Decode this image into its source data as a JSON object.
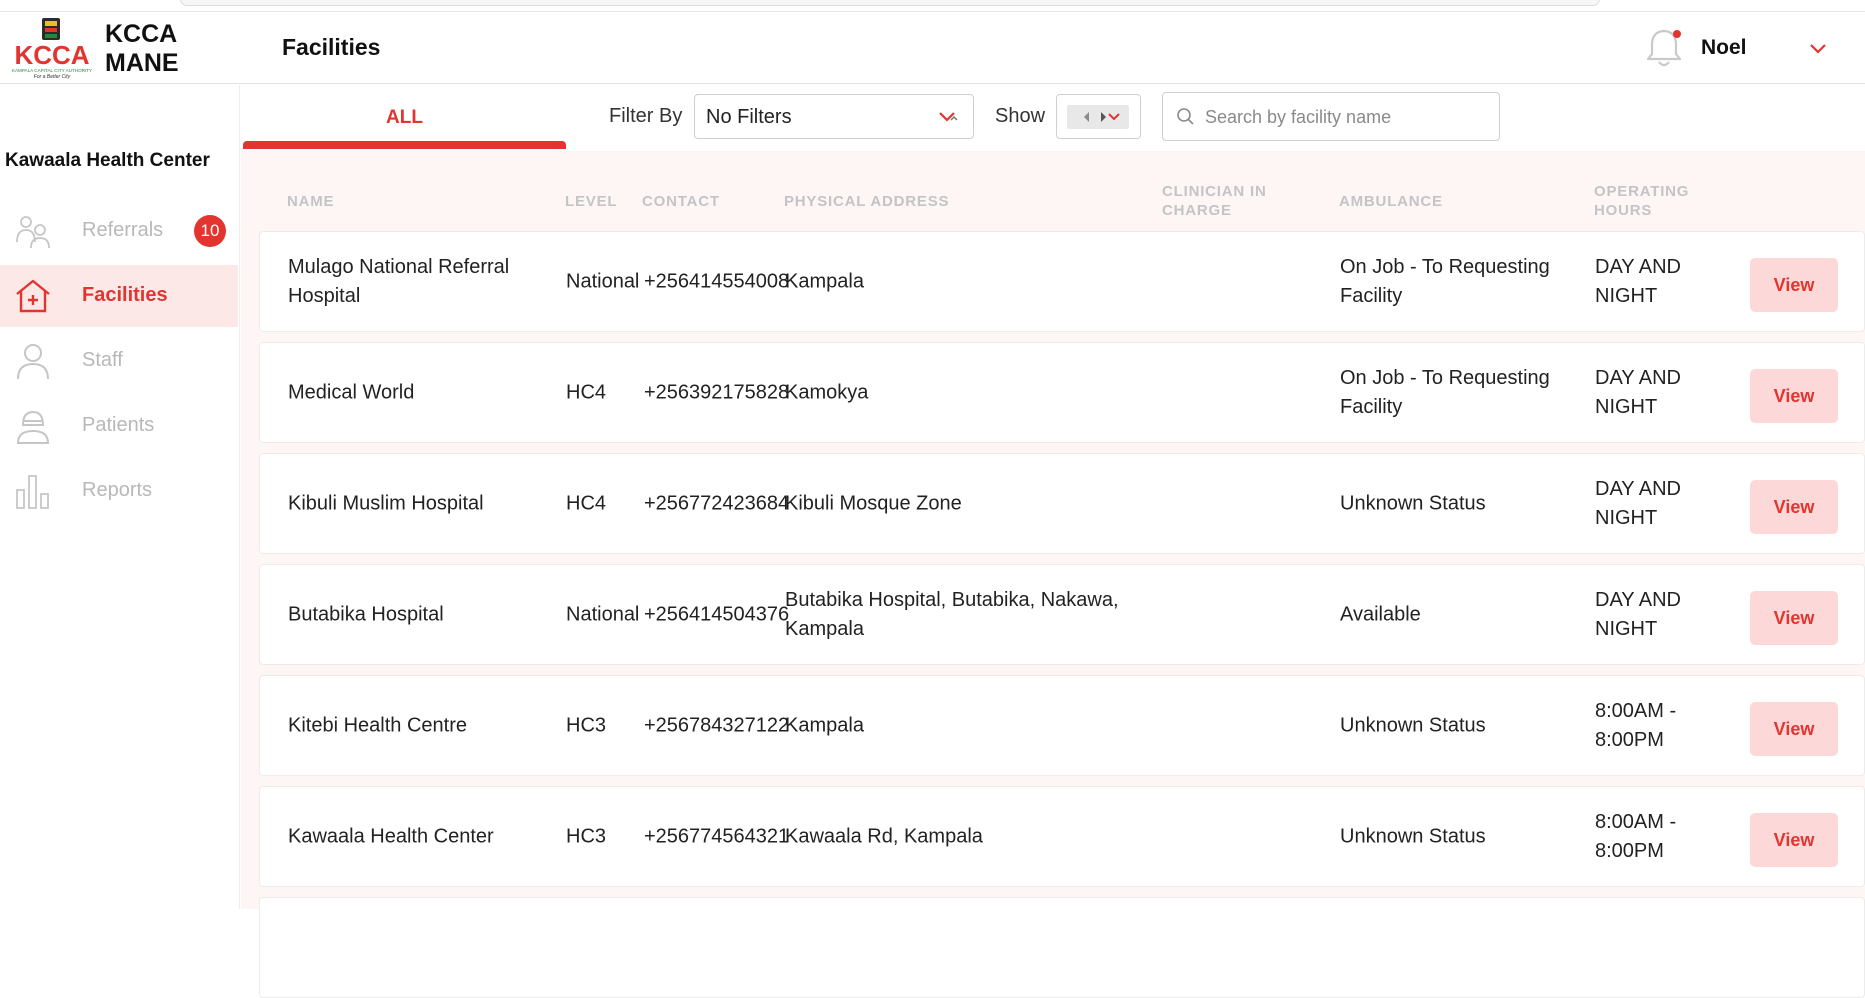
{
  "app": {
    "logo_text": "KCCA",
    "logo_subtext": "KAMPALA CAPITAL CITY AUTHORITY",
    "logo_tagline": "For a Better City",
    "brand_line1": "KCCA",
    "brand_line2": "MANE"
  },
  "header": {
    "title": "Facilities",
    "user_name": "Noel"
  },
  "sidebar": {
    "facility_name": "Kawaala Health Center",
    "items": [
      {
        "label": "Referrals",
        "icon": "referrals-icon",
        "badge": "10"
      },
      {
        "label": "Facilities",
        "icon": "hospital-icon",
        "active": true
      },
      {
        "label": "Staff",
        "icon": "user-icon"
      },
      {
        "label": "Patients",
        "icon": "patient-icon"
      },
      {
        "label": "Reports",
        "icon": "bar-chart-icon"
      }
    ]
  },
  "toolbar": {
    "tab_all": "ALL",
    "filter_label": "Filter By",
    "filter_value": "No Filters",
    "show_label": "Show",
    "search_placeholder": "Search by facility name"
  },
  "table": {
    "columns": [
      {
        "label": "NAME"
      },
      {
        "label": "LEVEL"
      },
      {
        "label": "CONTACT"
      },
      {
        "label": "PHYSICAL ADDRESS"
      },
      {
        "label": "CLINICIAN IN CHARGE"
      },
      {
        "label": "AMBULANCE"
      },
      {
        "label": "OPERATING HOURS"
      }
    ],
    "view_label": "View",
    "rows": [
      {
        "name": "Mulago National Referral Hospital",
        "level": "National",
        "contact": "+256414554008",
        "address": "Kampala",
        "clinician": "",
        "ambulance": "On Job - To Requesting Facility",
        "hours": "DAY AND NIGHT"
      },
      {
        "name": "Medical World",
        "level": "HC4",
        "contact": "+256392175828",
        "address": "Kamokya",
        "clinician": "",
        "ambulance": "On Job - To Requesting Facility",
        "hours": "DAY AND NIGHT"
      },
      {
        "name": "Kibuli Muslim Hospital",
        "level": "HC4",
        "contact": "+256772423684",
        "address": "Kibuli Mosque Zone",
        "clinician": "",
        "ambulance": "Unknown Status",
        "hours": "DAY AND NIGHT"
      },
      {
        "name": "Butabika Hospital",
        "level": "National",
        "contact": "+256414504376",
        "address": "Butabika Hospital, Butabika, Nakawa, Kampala",
        "clinician": "",
        "ambulance": "Available",
        "hours": "DAY AND NIGHT"
      },
      {
        "name": "Kitebi Health Centre",
        "level": "HC3",
        "contact": "+256784327122",
        "address": "Kampala",
        "clinician": "",
        "ambulance": "Unknown Status",
        "hours": "8:00AM - 8:00PM"
      },
      {
        "name": "Kawaala Health Center",
        "level": "HC3",
        "contact": "+256774564321",
        "address": "Kawaala Rd, Kampala",
        "clinician": "",
        "ambulance": "Unknown Status",
        "hours": "8:00AM - 8:00PM"
      }
    ]
  },
  "colors": {
    "accent": "#e3342f",
    "accent_light": "#fcd9d8",
    "active_nav_bg": "#fde8e8",
    "table_bg": "#fdf6f5",
    "header_text_muted": "#c4c4c6",
    "sidebar_text_muted": "#b8b8b8"
  }
}
